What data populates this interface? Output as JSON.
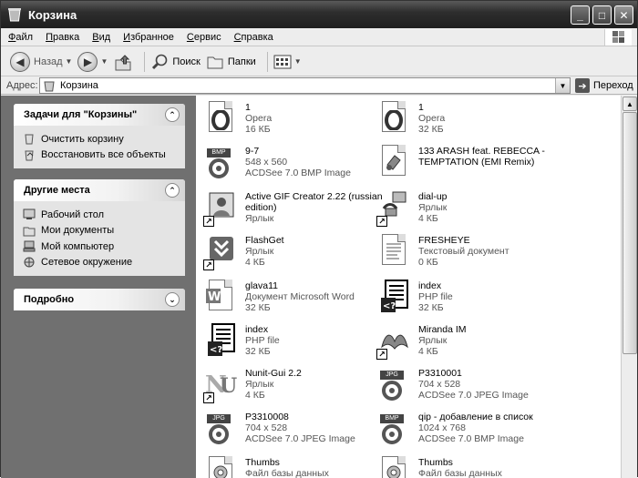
{
  "window": {
    "title": "Корзина",
    "buttons": {
      "minimize": "_",
      "maximize": "□",
      "close": "✕"
    }
  },
  "menu": {
    "items": [
      {
        "ul": "Ф",
        "rest": "айл"
      },
      {
        "ul": "П",
        "rest": "равка"
      },
      {
        "ul": "В",
        "rest": "ид"
      },
      {
        "ul": "И",
        "rest": "збранное"
      },
      {
        "ul": "С",
        "rest": "ервис"
      },
      {
        "ul": "С",
        "rest": "правка"
      }
    ]
  },
  "toolbar": {
    "back": "Назад",
    "search": "Поиск",
    "folders": "Папки"
  },
  "address": {
    "label": "Адрес:",
    "value": "Корзина",
    "go": "Переход"
  },
  "left": {
    "tasks": {
      "title": "Задачи для \"Корзины\"",
      "items": [
        "Очистить корзину",
        "Восстановить все объекты"
      ]
    },
    "places": {
      "title": "Другие места",
      "items": [
        "Рабочий стол",
        "Мои документы",
        "Мой компьютер",
        "Сетевое окружение"
      ]
    },
    "details": {
      "title": "Подробно"
    }
  },
  "files": [
    {
      "name": "1",
      "l2": "Opera",
      "l3": "16 КБ",
      "icon": "opera-icon"
    },
    {
      "name": "1",
      "l2": "Opera",
      "l3": "32 КБ",
      "icon": "opera-icon"
    },
    {
      "name": "9-7",
      "l2": "548 x 560",
      "l3": "ACDSee 7.0 BMP Image",
      "icon": "bmp-image-icon"
    },
    {
      "name": "133 ARASH feat. REBECCA - TEMPTATION (EMI Remix)",
      "l2": "",
      "l3": "",
      "icon": "audio-file-icon"
    },
    {
      "name": "Active GIF Creator 2.22 (russian edition)",
      "l2": "Ярлык",
      "l3": "",
      "icon": "gif-creator-shortcut-icon"
    },
    {
      "name": "dial-up",
      "l2": "Ярлык",
      "l3": "4 КБ",
      "icon": "dialup-shortcut-icon"
    },
    {
      "name": "FlashGet",
      "l2": "Ярлык",
      "l3": "4 КБ",
      "icon": "flashget-shortcut-icon"
    },
    {
      "name": "FRESHEYE",
      "l2": "Текстовый документ",
      "l3": "0 КБ",
      "icon": "text-document-icon"
    },
    {
      "name": "glava11",
      "l2": "Документ Microsoft Word",
      "l3": "32 КБ",
      "icon": "word-document-icon"
    },
    {
      "name": "index",
      "l2": "PHP file",
      "l3": "32 КБ",
      "icon": "php-file-icon"
    },
    {
      "name": "index",
      "l2": "PHP file",
      "l3": "32 КБ",
      "icon": "php-file-icon"
    },
    {
      "name": "Miranda IM",
      "l2": "Ярлык",
      "l3": "4 КБ",
      "icon": "miranda-shortcut-icon"
    },
    {
      "name": "Nunit-Gui 2.2",
      "l2": "Ярлык",
      "l3": "4 КБ",
      "icon": "nunit-shortcut-icon"
    },
    {
      "name": "P3310001",
      "l2": "704 x 528",
      "l3": "ACDSee 7.0 JPEG Image",
      "icon": "jpeg-image-icon"
    },
    {
      "name": "P3310008",
      "l2": "704 x 528",
      "l3": "ACDSee 7.0 JPEG Image",
      "icon": "jpeg-image-icon"
    },
    {
      "name": "qip - добавление в список",
      "l2": "1024 x 768",
      "l3": "ACDSee 7.0 BMP Image",
      "icon": "bmp-image-icon"
    },
    {
      "name": "Thumbs",
      "l2": "Файл базы данных",
      "l3": "",
      "icon": "database-file-icon"
    },
    {
      "name": "Thumbs",
      "l2": "Файл базы данных",
      "l3": "",
      "icon": "database-file-icon"
    }
  ],
  "tags": {
    "bmp": "BMP",
    "jpg": "JPG"
  }
}
